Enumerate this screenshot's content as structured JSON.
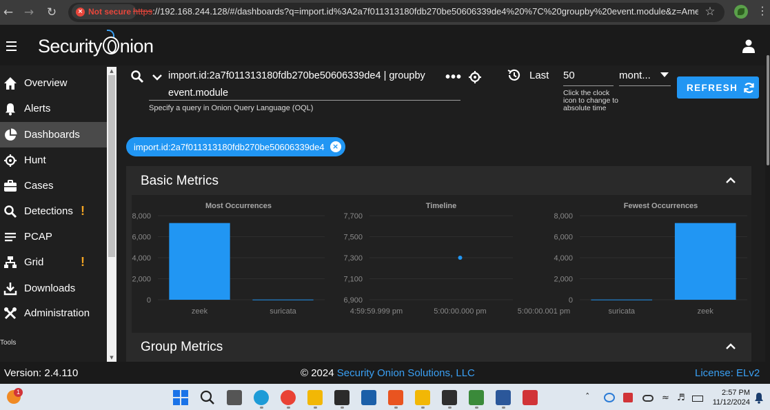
{
  "browser": {
    "security_label": "Not secure",
    "url_scheme": "https",
    "url_rest": "://192.168.244.128/#/dashboards?q=import.id%3A2a7f011313180fdb270be50606339de4%20%7C%20groupby%20event.module&z=America..."
  },
  "app": {
    "brand_before": "Security",
    "brand_after": "nion"
  },
  "sidebar": {
    "items": [
      {
        "label": "Overview",
        "icon": "home-icon"
      },
      {
        "label": "Alerts",
        "icon": "bell-icon"
      },
      {
        "label": "Dashboards",
        "icon": "pie-chart-icon",
        "active": true
      },
      {
        "label": "Hunt",
        "icon": "crosshair-icon"
      },
      {
        "label": "Cases",
        "icon": "briefcase-icon"
      },
      {
        "label": "Detections",
        "icon": "search-icon",
        "warning": "!"
      },
      {
        "label": "PCAP",
        "icon": "lines-icon"
      },
      {
        "label": "Grid",
        "icon": "network-icon",
        "warning": "!"
      },
      {
        "label": "Downloads",
        "icon": "download-icon"
      },
      {
        "label": "Administration",
        "icon": "tools-icon"
      }
    ],
    "tools_label": "Tools"
  },
  "query": {
    "text": "import.id:2a7f011313180fdb270be50606339de4 | groupby event.module",
    "hint": "Specify a query in Onion Query Language (OQL)",
    "more": "•••"
  },
  "time": {
    "last_label": "Last",
    "value": "50",
    "unit": "mont...",
    "hint": "Click the clock icon to change to absolute time"
  },
  "refresh_label": "REFRESH",
  "filter_chip": "import.id:2a7f011313180fdb270be50606339de4",
  "panels": {
    "basic_title": "Basic Metrics",
    "group_title": "Group Metrics"
  },
  "chart_data": [
    {
      "type": "bar",
      "title": "Most Occurrences",
      "categories": [
        "zeek",
        "suricata"
      ],
      "values": [
        7300,
        20
      ],
      "ylim": [
        0,
        8000
      ],
      "yticks": [
        "8,000",
        "6,000",
        "4,000",
        "2,000",
        "0"
      ],
      "color": "#2196f3"
    },
    {
      "type": "scatter",
      "title": "Timeline",
      "xticks": [
        "4:59:59.999 pm",
        "5:00:00.000 pm",
        "5:00:00.001 pm"
      ],
      "yticks": [
        "7,700",
        "7,500",
        "7,300",
        "7,100",
        "6,900"
      ],
      "ylim": [
        6900,
        7700
      ],
      "points": [
        {
          "x": "5:00:00.000 pm",
          "y": 7300
        }
      ],
      "color": "#2196f3"
    },
    {
      "type": "bar",
      "title": "Fewest Occurrences",
      "categories": [
        "suricata",
        "zeek"
      ],
      "values": [
        20,
        7300
      ],
      "ylim": [
        0,
        8000
      ],
      "yticks": [
        "8,000",
        "6,000",
        "4,000",
        "2,000",
        "0"
      ],
      "color": "#2196f3"
    }
  ],
  "footer": {
    "version": "Version: 2.4.110",
    "copyright_prefix": "© 2024 ",
    "copyright_link": "Security Onion Solutions, LLC",
    "license": "License: ELv2"
  },
  "taskbar": {
    "notification_count": "1",
    "time": "2:57 PM",
    "date": "11/12/2024",
    "apps": [
      "start-icon",
      "search-icon",
      "task-view-icon",
      "edge-icon",
      "chrome-icon",
      "file-explorer-icon",
      "sticky-notes-icon",
      "virtualbox-icon",
      "ubuntu-icon",
      "folder-tool-icon",
      "terminal-icon",
      "network-tool-icon",
      "word-icon",
      "snipping-icon"
    ],
    "app_colors": [
      "#1a73e8",
      "#222222",
      "#555555",
      "#1d9bd7",
      "#e94235",
      "#f2b705",
      "#2b2b2b",
      "#1b5fa8",
      "#e95420",
      "#f2b705",
      "#2e2e2e",
      "#3a8a3a",
      "#2b579a",
      "#d13438"
    ]
  }
}
